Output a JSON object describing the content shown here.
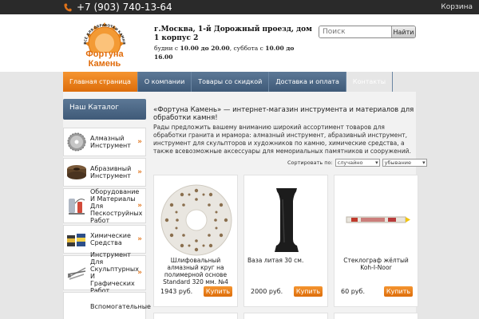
{
  "topbar": {
    "phone": "+7 (903) 740-13-64",
    "cart": "Корзина"
  },
  "logo": {
    "arc_text": "ВСЁ ДЛЯ ОБРАБОТКИ КАМНЯ",
    "line1": "Фортуна",
    "line2": "Камень"
  },
  "header": {
    "address": "г.Москва, 1-й Дорожный проезд, дом 1 корпус 2",
    "hours_prefix": "будни с ",
    "hours_weekday": "10.00 до 20.00",
    "hours_mid": ", суббота с ",
    "hours_sat": "10.00 до 16.00"
  },
  "search": {
    "placeholder": "Поиск",
    "button": "Найти"
  },
  "nav": {
    "items": [
      "Главная страница",
      "О компании",
      "Товары со скидкой",
      "Доставка и оплата",
      "Контакты"
    ]
  },
  "catalog": {
    "title": "Наш Каталог",
    "items": [
      {
        "label": "Алмазный Инструмент",
        "icon": "diamond-disc-icon"
      },
      {
        "label": "Абразивный Инструмент",
        "icon": "abrasive-wheel-icon"
      },
      {
        "label": "Оборудование И Материалы Для Пескоструйных Работ",
        "icon": "sandblast-equipment-icon"
      },
      {
        "label": "Химические Средства",
        "icon": "chemicals-icon"
      },
      {
        "label": "Инструмент Для Скульптурных И Графических Работ",
        "icon": "sculpting-tools-icon"
      },
      {
        "label": "Вспомогательные",
        "icon": "auxiliary-icon"
      }
    ]
  },
  "intro": {
    "title": "«Фортуна Камень» — интернет-магазин  инструмента и материалов для обработки камня!",
    "text": "Рады предложить вашему вниманию широкий ассортимент товаров для обработки гранита и мрамора: алмазный инструмент, абразивный инструмент, инструмент для скульпторов и художников по камню, химические средства, а также всевозможные аксессуары для мемориальных памятников и сооружений."
  },
  "sort": {
    "label": "Сортировать по:",
    "order_by": "случайно",
    "direction": "убывание"
  },
  "products": [
    {
      "name": "Шлифовальный алмазный круг на полимерной основе Standard 320 мм. №4",
      "price": "1943 руб.",
      "buy": "Купить",
      "image": "polishing-disc-image"
    },
    {
      "name": "Ваза литая 30 см.",
      "price": "2000 руб.",
      "buy": "Купить",
      "image": "granite-vase-image"
    },
    {
      "name": "Стеклограф жёлтый Koh-I-Noor",
      "price": "60 руб.",
      "buy": "Купить",
      "image": "wax-pencil-image"
    }
  ],
  "colors": {
    "accent_orange": "#e0731a",
    "nav_blue": "#4a6584",
    "topbar": "#2a2a2a",
    "logo_orange": "#e06b0a"
  }
}
